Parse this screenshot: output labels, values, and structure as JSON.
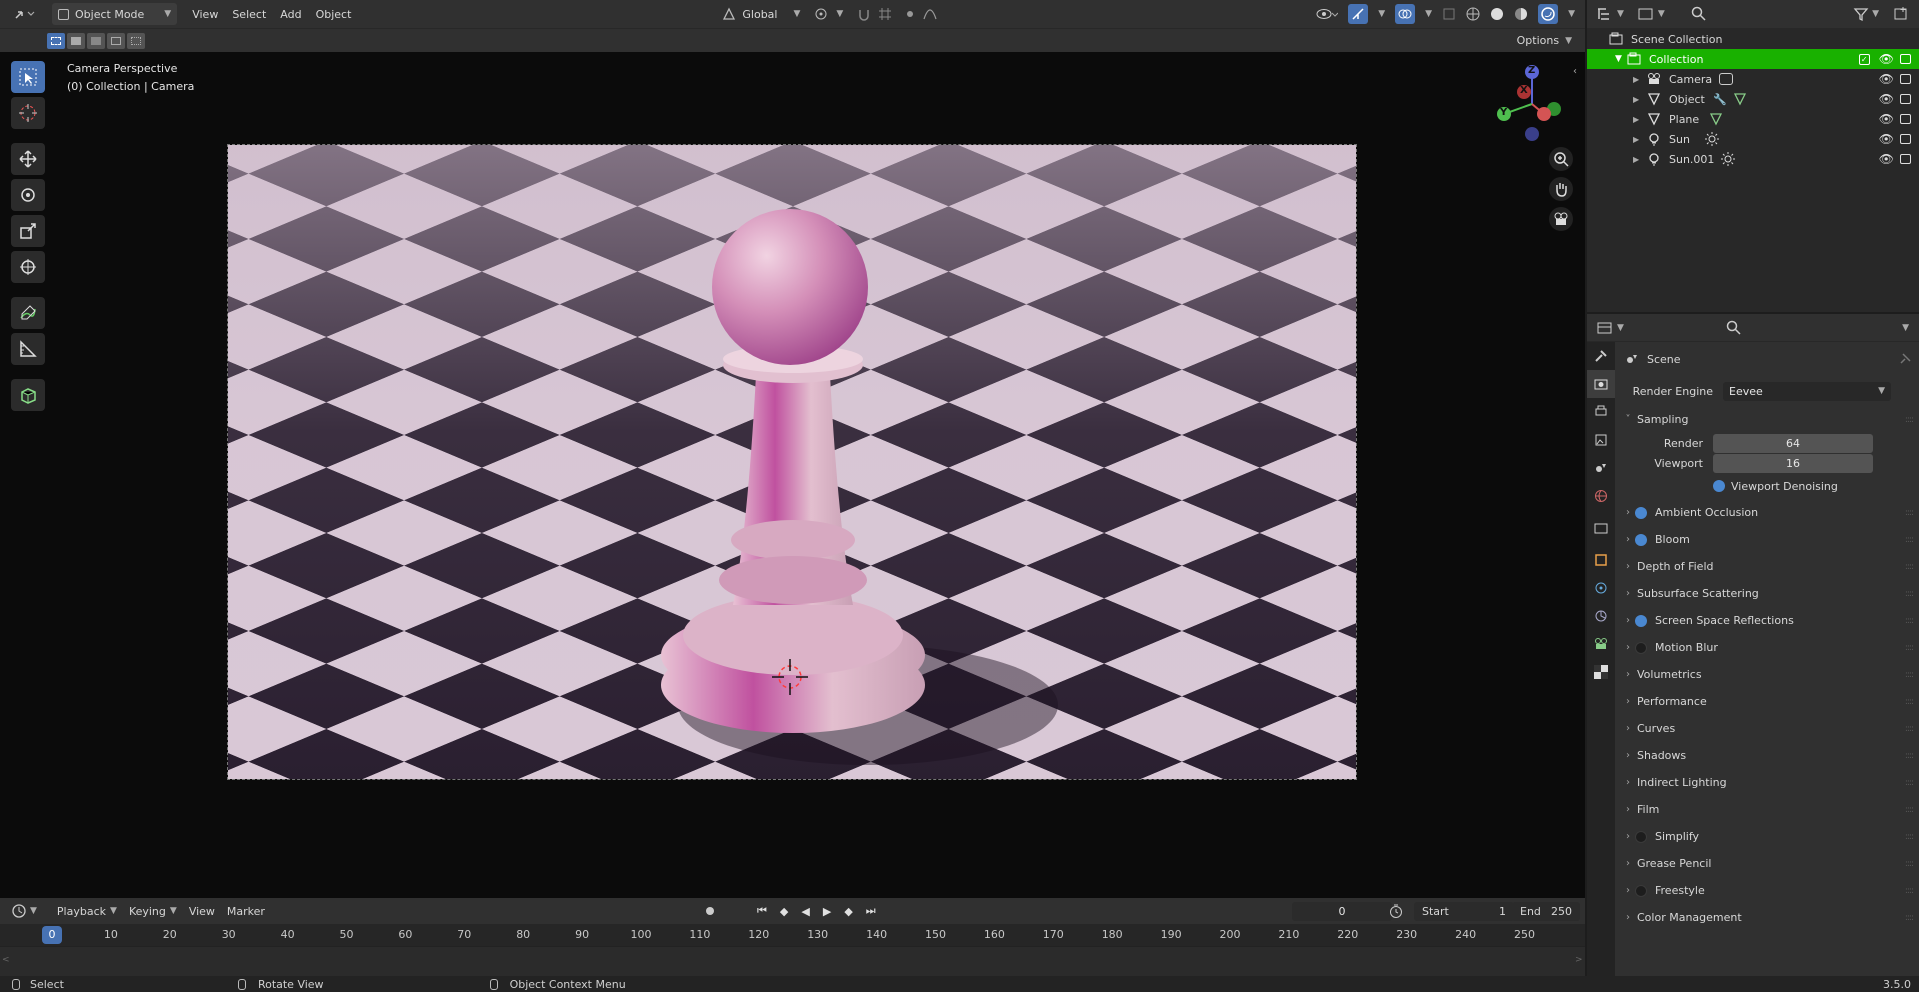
{
  "viewport": {
    "header": {
      "mode": "Object Mode",
      "menus": [
        "View",
        "Select",
        "Add",
        "Object"
      ],
      "orientation": "Global",
      "options": "Options"
    },
    "overlay_text": {
      "perspective": "Camera Perspective",
      "collection": "(0) Collection | Camera"
    },
    "gizmo": {
      "z": "Z",
      "y": "Y",
      "x": "X"
    }
  },
  "outliner": {
    "root": "Scene Collection",
    "collection": "Collection",
    "items": [
      {
        "label": "Camera",
        "icon": "camera-icon"
      },
      {
        "label": "Object",
        "icon": "mesh-icon"
      },
      {
        "label": "Plane",
        "icon": "mesh-icon"
      },
      {
        "label": "Sun",
        "icon": "light-icon"
      },
      {
        "label": "Sun.001",
        "icon": "light-icon"
      }
    ]
  },
  "properties": {
    "context": "Scene",
    "render_engine_label": "Render Engine",
    "render_engine": "Eevee",
    "sampling": {
      "title": "Sampling",
      "render_label": "Render",
      "render_value": "64",
      "viewport_label": "Viewport",
      "viewport_value": "16",
      "denoise": "Viewport Denoising"
    },
    "panels": [
      {
        "label": "Ambient Occlusion",
        "checkbox": "on"
      },
      {
        "label": "Bloom",
        "checkbox": "on"
      },
      {
        "label": "Depth of Field",
        "checkbox": "none"
      },
      {
        "label": "Subsurface Scattering",
        "checkbox": "none"
      },
      {
        "label": "Screen Space Reflections",
        "checkbox": "on"
      },
      {
        "label": "Motion Blur",
        "checkbox": "off"
      },
      {
        "label": "Volumetrics",
        "checkbox": "none"
      },
      {
        "label": "Performance",
        "checkbox": "none"
      },
      {
        "label": "Curves",
        "checkbox": "none"
      },
      {
        "label": "Shadows",
        "checkbox": "none"
      },
      {
        "label": "Indirect Lighting",
        "checkbox": "none"
      },
      {
        "label": "Film",
        "checkbox": "none"
      },
      {
        "label": "Simplify",
        "checkbox": "off"
      },
      {
        "label": "Grease Pencil",
        "checkbox": "none"
      },
      {
        "label": "Freestyle",
        "checkbox": "off"
      },
      {
        "label": "Color Management",
        "checkbox": "none"
      }
    ]
  },
  "timeline": {
    "menus": [
      "Playback",
      "Keying",
      "View",
      "Marker"
    ],
    "current_frame": "0",
    "start_label": "Start",
    "start": "1",
    "end_label": "End",
    "end": "250",
    "ticks": [
      "0",
      "10",
      "20",
      "30",
      "40",
      "50",
      "60",
      "70",
      "80",
      "90",
      "100",
      "110",
      "120",
      "130",
      "140",
      "150",
      "160",
      "170",
      "180",
      "190",
      "200",
      "210",
      "220",
      "230",
      "240",
      "250"
    ]
  },
  "statusbar": {
    "select": "Select",
    "rotate": "Rotate View",
    "context_menu": "Object Context Menu",
    "version": "3.5.0"
  },
  "colors": {
    "accent": "#4772b3",
    "selected_collection": "#19b100",
    "checkbox_on": "#4a88d1"
  }
}
